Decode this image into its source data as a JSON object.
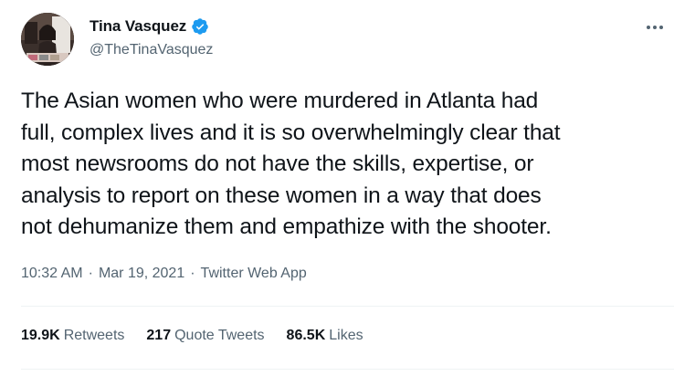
{
  "author": {
    "name": "Tina Vasquez",
    "handle": "@TheTinaVasquez",
    "verified": true,
    "avatar_icon": "profile-photo"
  },
  "tweet": {
    "lines": [
      "The Asian women who were murdered in Atlanta had",
      "full, complex lives and it is so overwhelmingly clear that",
      "most newsrooms do not have the skills, expertise, or",
      "analysis to report on these women in a way that does",
      "not dehumanize them and empathize with the shooter."
    ],
    "time": "10:32 AM",
    "date": "Mar 19, 2021",
    "separator": "·",
    "source": "Twitter Web App"
  },
  "stats": {
    "retweets_count": "19.9K",
    "retweets_label": "Retweets",
    "quotes_count": "217",
    "quotes_label": "Quote Tweets",
    "likes_count": "86.5K",
    "likes_label": "Likes"
  },
  "colors": {
    "verified": "#1d9bf0",
    "secondary_text": "#536471",
    "primary_text": "#0f1419",
    "divider": "#eff3f4"
  },
  "icons": {
    "more": "more-horizontal-icon",
    "verified": "verified-badge-icon"
  }
}
